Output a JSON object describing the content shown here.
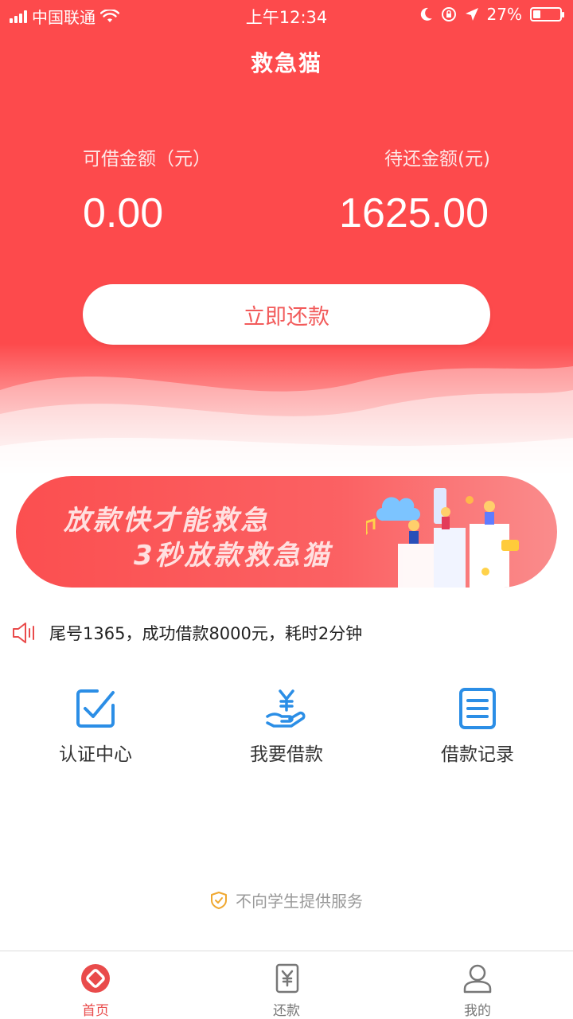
{
  "status_bar": {
    "carrier": "中国联通",
    "time": "上午12:34",
    "battery": "27%",
    "battery_level": 0.27
  },
  "header": {
    "title": "救急猫"
  },
  "summary": {
    "available_label": "可借金额（元）",
    "available_value": "0.00",
    "due_label": "待还金额(元)",
    "due_value": "1625.00"
  },
  "repay_button_label": "立即还款",
  "banner": {
    "line1": "放款快才能救急",
    "line2": "3秒放款救急猫"
  },
  "notice": {
    "text": "尾号1365，成功借款8000元，耗时2分钟"
  },
  "features": [
    {
      "label": "认证中心",
      "icon": "checkbox-icon"
    },
    {
      "label": "我要借款",
      "icon": "hand-yen-icon"
    },
    {
      "label": "借款记录",
      "icon": "list-document-icon"
    }
  ],
  "footnote": {
    "text": "不向学生提供服务"
  },
  "tabbar": {
    "active_color": "#e94b4b",
    "inactive_color": "#777777",
    "tabs": [
      {
        "label": "首页",
        "icon": "home-diamond-icon",
        "active": true
      },
      {
        "label": "还款",
        "icon": "yen-receipt-icon",
        "active": false
      },
      {
        "label": "我的",
        "icon": "user-icon",
        "active": false
      }
    ]
  },
  "colors": {
    "brand_red": "#fd4a4c",
    "feature_blue": "#2b8ee6",
    "shield_orange": "#f0a830"
  }
}
